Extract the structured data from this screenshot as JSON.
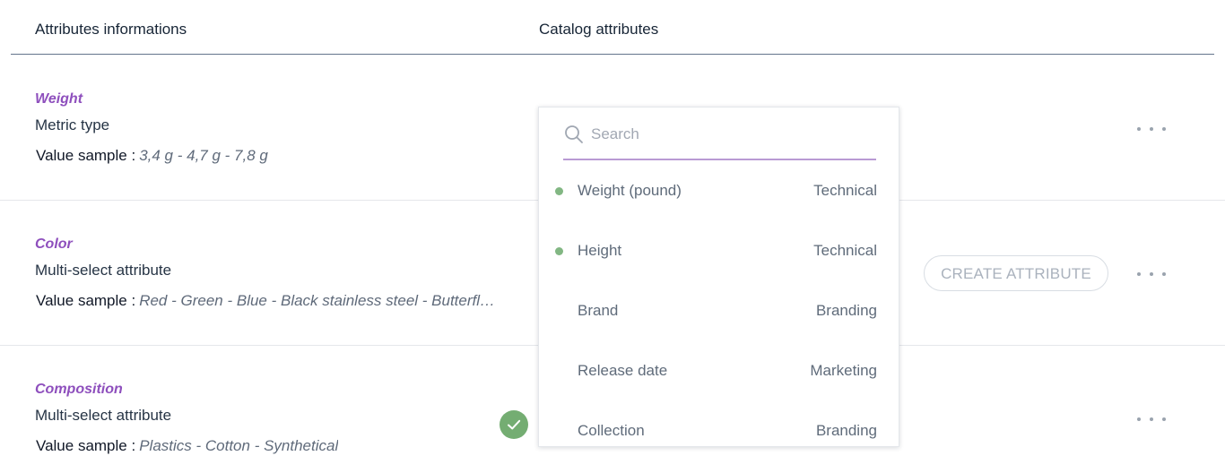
{
  "header": {
    "left_title": "Attributes informations",
    "right_title": "Catalog attributes"
  },
  "attributes": [
    {
      "name": "Weight",
      "type": "Metric type",
      "value_sample_label": "Value sample :",
      "value_sample": "3,4 g - 4,7 g - 7,8 g"
    },
    {
      "name": "Color",
      "type": "Multi-select attribute",
      "value_sample_label": "Value sample :",
      "value_sample": "Red - Green - Blue - Black stainless steel - Butterfly ye…"
    },
    {
      "name": "Composition",
      "type": "Multi-select attribute",
      "value_sample_label": "Value sample :",
      "value_sample": "Plastics - Cotton - Synthetical"
    }
  ],
  "actions": {
    "create_attribute": "CREATE ATTRIBUTE"
  },
  "dropdown": {
    "search_placeholder": "Search",
    "options": [
      {
        "name": "Weight (pound)",
        "category": "Technical",
        "status": "mapped"
      },
      {
        "name": "Height",
        "category": "Technical",
        "status": "mapped"
      },
      {
        "name": "Brand",
        "category": "Branding",
        "status": ""
      },
      {
        "name": "Release date",
        "category": "Marketing",
        "status": ""
      },
      {
        "name": "Collection",
        "category": "Branding",
        "status": ""
      }
    ]
  },
  "icons": {
    "search": "search-icon",
    "more": "more-horizontal-icon",
    "check": "check-icon"
  },
  "colors": {
    "accent_purple": "#8e4fbd",
    "search_underline": "#b99ad4",
    "status_green": "#82b783",
    "check_green": "#74ad72"
  }
}
